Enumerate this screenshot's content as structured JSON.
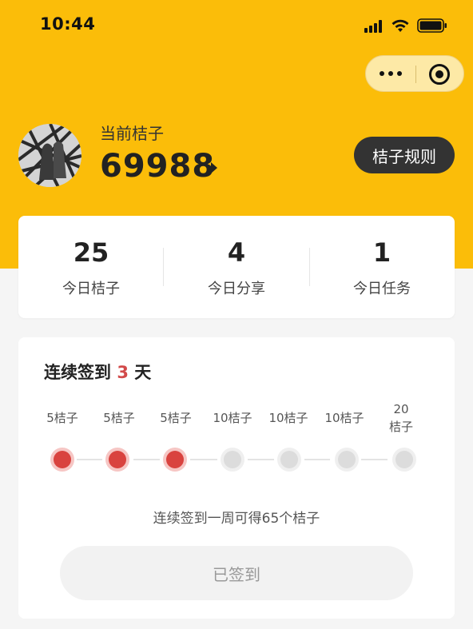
{
  "status_bar": {
    "time": "10:44"
  },
  "profile": {
    "current_label": "当前桔子",
    "points": "69988",
    "rules_button": "桔子规则"
  },
  "stats": [
    {
      "value": "25",
      "label": "今日桔子"
    },
    {
      "value": "4",
      "label": "今日分享"
    },
    {
      "value": "1",
      "label": "今日任务"
    }
  ],
  "checkin": {
    "title_prefix": "连续签到",
    "days": "3",
    "title_suffix": "天",
    "rewards": [
      "5桔子",
      "5桔子",
      "5桔子",
      "10桔子",
      "10桔子",
      "10桔子",
      "20桔子"
    ],
    "completed_days": 3,
    "hint": "连续签到一周可得65个桔子",
    "button_label": "已签到"
  },
  "colors": {
    "header": "#fbbd09",
    "accent_red": "#d9433f",
    "dark_button": "#333333"
  }
}
